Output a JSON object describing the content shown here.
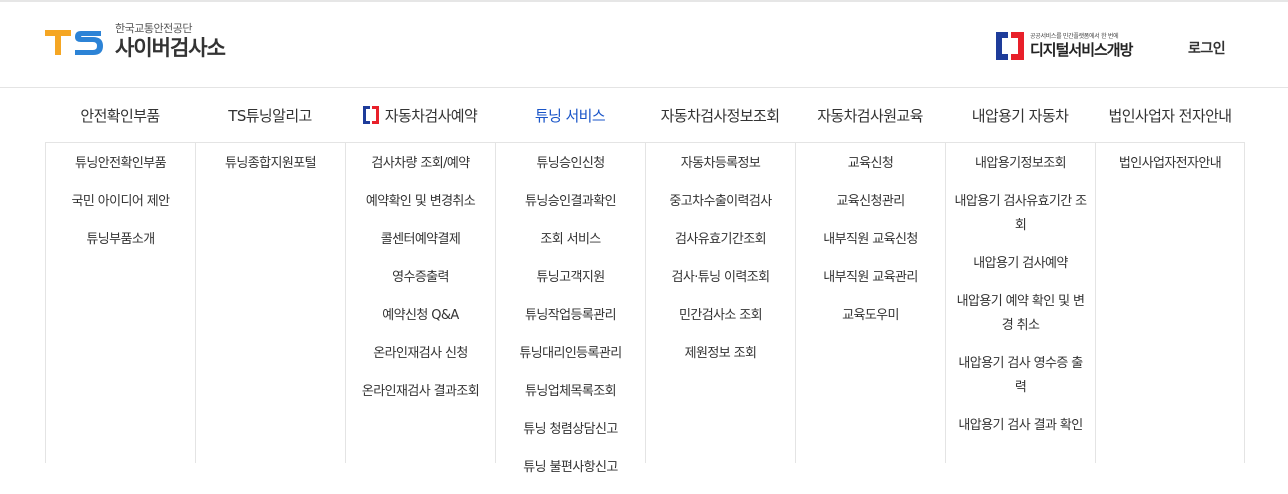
{
  "header": {
    "logo_sub": "한국교통안전공단",
    "logo_main": "사이버검사소",
    "digital_sub": "공공서비스를 민간플랫폼에서 한 번에",
    "digital_main": "디지털서비스개방",
    "login_label": "로그인"
  },
  "colors": {
    "accent": "#1a55c8",
    "ts_orange": "#f5a623",
    "ts_blue": "#2c83d6",
    "digital_red": "#e8202a",
    "digital_blue": "#1e3c9a"
  },
  "nav": [
    {
      "label": "안전확인부품"
    },
    {
      "label": "TS튜닝알리고"
    },
    {
      "label": "자동차검사예약",
      "icon": "digital-service-mark-icon"
    },
    {
      "label": "튜닝 서비스",
      "active": true
    },
    {
      "label": "자동차검사정보조회"
    },
    {
      "label": "자동차검사원교육"
    },
    {
      "label": "내압용기 자동차"
    },
    {
      "label": "법인사업자 전자안내"
    }
  ],
  "menu": [
    [
      "튜닝안전확인부품",
      "국민 아이디어 제안",
      "튜닝부품소개"
    ],
    [
      "튜닝종합지원포털"
    ],
    [
      "검사차량 조회/예약",
      "예약확인 및 변경취소",
      "콜센터예약결제",
      "영수증출력",
      "예약신청 Q&A",
      "온라인재검사 신청",
      "온라인재검사 결과조회"
    ],
    [
      "튜닝승인신청",
      "튜닝승인결과확인",
      "조회 서비스",
      "튜닝고객지원",
      "튜닝작업등록관리",
      "튜닝대리인등록관리",
      "튜닝업체목록조회",
      "튜닝 청렴상담신고",
      "튜닝 불편사항신고"
    ],
    [
      "자동차등록정보",
      "중고차수출이력검사",
      "검사유효기간조회",
      "검사·튜닝 이력조회",
      "민간검사소 조회",
      "제원정보 조회"
    ],
    [
      "교육신청",
      "교육신청관리",
      "내부직원 교육신청",
      "내부직원 교육관리",
      "교육도우미"
    ],
    [
      "내압용기정보조회",
      "내압용기 검사유효기간 조회",
      "내압용기 검사예약",
      "내압용기 예약 확인 및 변경 취소",
      "내압용기 검사 영수증 출력",
      "내압용기 검사 결과 확인"
    ],
    [
      "법인사업자전자안내"
    ]
  ]
}
